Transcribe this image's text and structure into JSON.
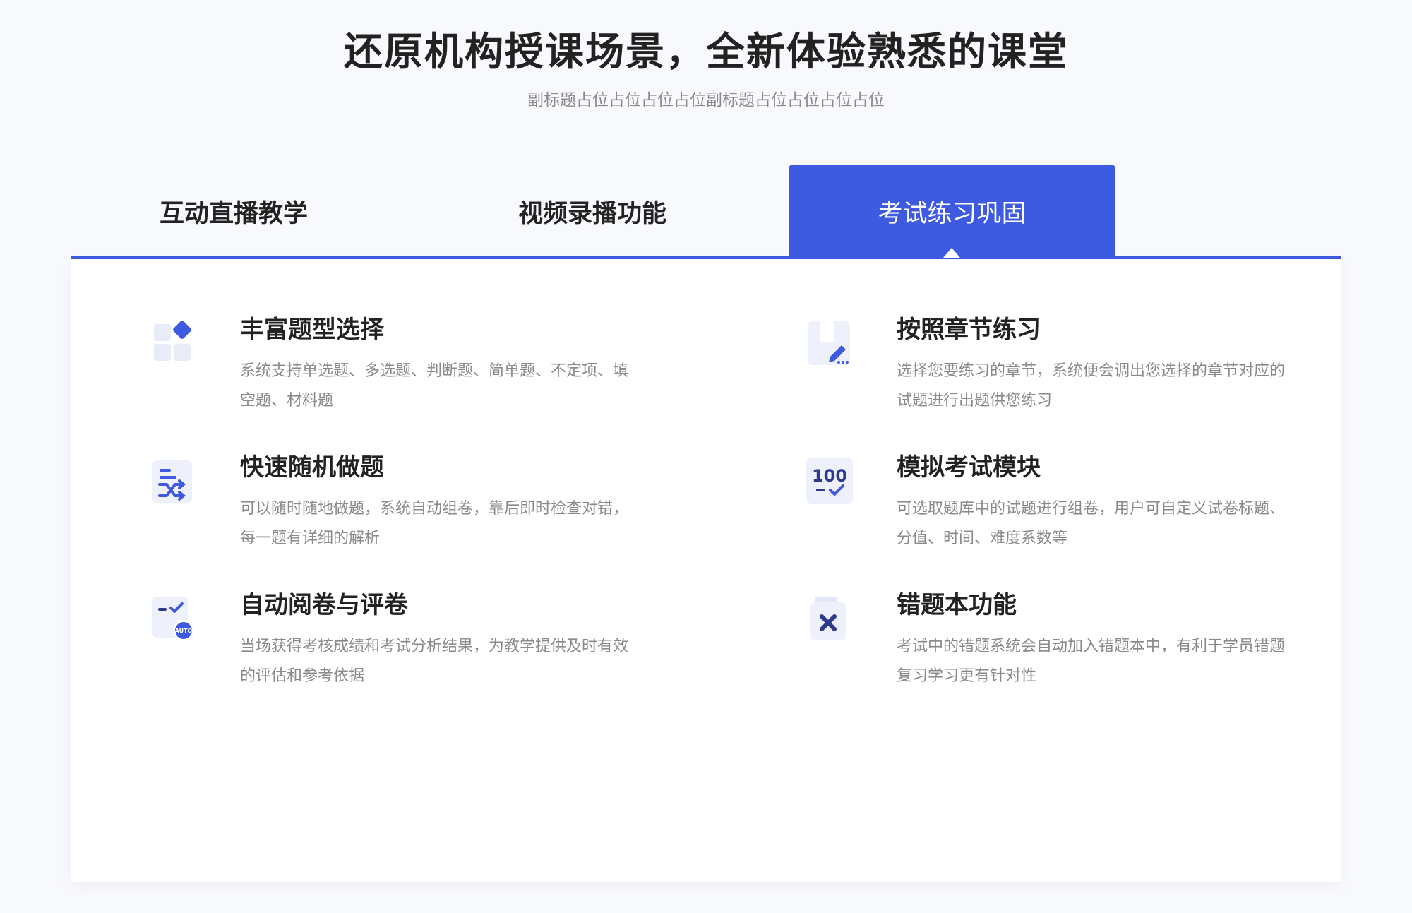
{
  "header": {
    "title": "还原机构授课场景，全新体验熟悉的课堂",
    "subtitle": "副标题占位占位占位占位副标题占位占位占位占位"
  },
  "tabs": [
    {
      "label": "互动直播教学",
      "active": false
    },
    {
      "label": "视频录播功能",
      "active": false
    },
    {
      "label": "考试练习巩固",
      "active": true
    }
  ],
  "colors": {
    "accent": "#3d5ae0",
    "icon_light": "#eef1fb",
    "icon_mid": "#d6def6"
  },
  "features": [
    {
      "icon": "question-types-icon",
      "title": "丰富题型选择",
      "desc": "系统支持单选题、多选题、判断题、简单题、不定项、填空题、材料题"
    },
    {
      "icon": "chapter-practice-icon",
      "title": "按照章节练习",
      "desc": "选择您要练习的章节，系统便会调出您选择的章节对应的试题进行出题供您练习"
    },
    {
      "icon": "random-shuffle-icon",
      "title": "快速随机做题",
      "desc": "可以随时随地做题，系统自动组卷，靠后即时检查对错，每一题有详细的解析"
    },
    {
      "icon": "score-100-icon",
      "title": "模拟考试模块",
      "desc": "可选取题库中的试题进行组卷，用户可自定义试卷标题、分值、时间、难度系数等"
    },
    {
      "icon": "auto-grading-icon",
      "title": "自动阅卷与评卷",
      "desc": "当场获得考核成绩和考试分析结果，为教学提供及时有效的评估和参考依据",
      "badge": "AUTO"
    },
    {
      "icon": "wrong-answers-icon",
      "title": "错题本功能",
      "desc": "考试中的错题系统会自动加入错题本中，有利于学员错题复习学习更有针对性"
    }
  ]
}
